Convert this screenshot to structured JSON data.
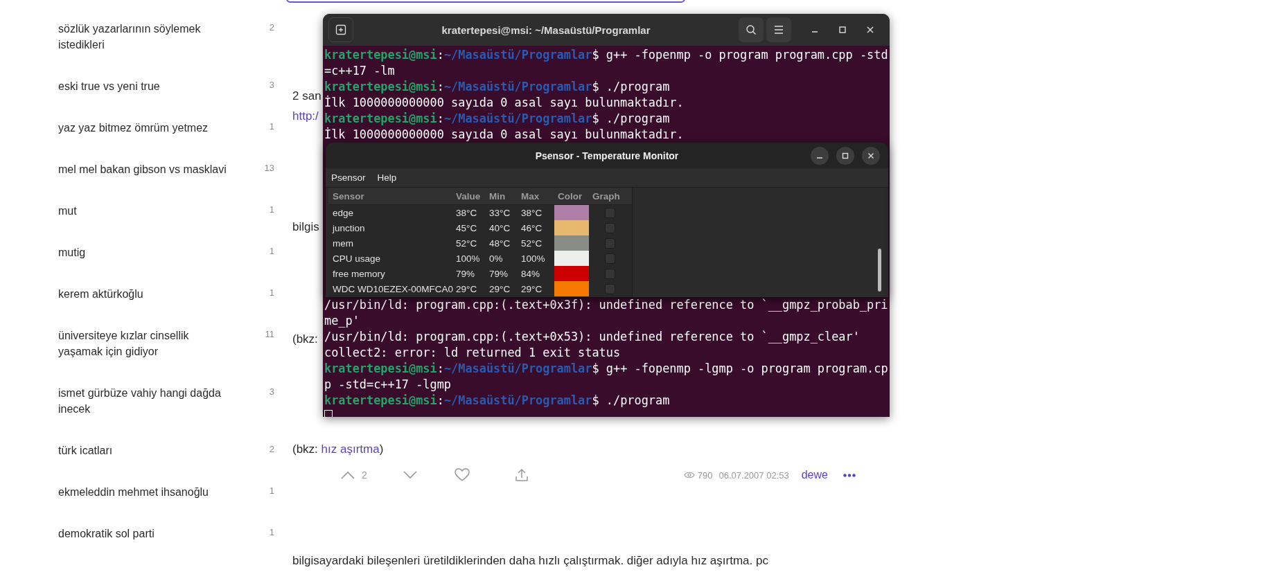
{
  "sidebar": {
    "items": [
      {
        "title": "sözlük yazarlarının söylemek istedikleri",
        "count": "2"
      },
      {
        "title": "eski true vs yeni true",
        "count": "3"
      },
      {
        "title": "yaz yaz bitmez ömrüm yetmez",
        "count": "1"
      },
      {
        "title": "mel mel bakan gibson vs masklavi",
        "count": "13"
      },
      {
        "title": "mut",
        "count": "1"
      },
      {
        "title": "mutig",
        "count": "1"
      },
      {
        "title": "kerem aktürkoğlu",
        "count": "1"
      },
      {
        "title": "üniversiteye kızlar cinsellik yaşamak için gidiyor",
        "count": "11"
      },
      {
        "title": "ismet gürbüze vahiy hangi dağda inecek",
        "count": "3"
      },
      {
        "title": "türk icatları",
        "count": "2"
      },
      {
        "title": "ekmeleddin mehmet ihsanoğlu",
        "count": "1"
      },
      {
        "title": "demokratik sol parti",
        "count": "1"
      }
    ]
  },
  "content": {
    "blocks": [
      {
        "kind": "text",
        "text": "2 san"
      },
      {
        "kind": "link",
        "text": "http:/"
      },
      {
        "kind": "text",
        "text": "bilgis"
      },
      {
        "kind": "text",
        "text": "(bkz:"
      },
      {
        "kind": "bkz",
        "prefix": "(bkz: ",
        "link": "hız aşırtma",
        "suffix": ")"
      },
      {
        "kind": "footer",
        "upvotes": "2",
        "views": "790",
        "date": "06.07.2007 02:53",
        "author": "dewe"
      },
      {
        "kind": "text",
        "text": "bilgisayardaki bileşenleri üretildiklerinden daha hızlı çalıştırmak. diğer adıyla hız aşırtma. pc"
      }
    ]
  },
  "terminal": {
    "title": "kratertepesi@msi: ~/Masaüstü/Programlar",
    "cursor_visible": true,
    "lines_top": [
      {
        "kind": "prompt",
        "user": "kratertepesi@msi",
        "separator": ":",
        "path": "~/Masaüstü/Programlar",
        "command": "$ g++ -fopenmp -o program program.cpp -std"
      },
      {
        "kind": "output",
        "text": "=c++17 -lm"
      },
      {
        "kind": "prompt",
        "user": "kratertepesi@msi",
        "separator": ":",
        "path": "~/Masaüstü/Programlar",
        "command": "$ ./program"
      },
      {
        "kind": "output",
        "text": "İlk 1000000000000 sayıda 0 asal sayı bulunmaktadır."
      },
      {
        "kind": "prompt",
        "user": "kratertepesi@msi",
        "separator": ":",
        "path": "~/Masaüstü/Programlar",
        "command": "$ ./program"
      },
      {
        "kind": "output",
        "text": "İlk 1000000000000 sayıda 0 asal sayı bulunmaktadır."
      }
    ],
    "lines_bottom": [
      {
        "kind": "output",
        "text": "/usr/bin/ld: program.cpp:(.text+0x3f): undefined reference to `__gmpz_probab_pri"
      },
      {
        "kind": "output",
        "text": "me_p'"
      },
      {
        "kind": "output",
        "text": "/usr/bin/ld: program.cpp:(.text+0x53): undefined reference to `__gmpz_clear'"
      },
      {
        "kind": "output",
        "text": "collect2: error: ld returned 1 exit status"
      },
      {
        "kind": "prompt",
        "user": "kratertepesi@msi",
        "separator": ":",
        "path": "~/Masaüstü/Programlar",
        "command": "$ g++ -fopenmp -lgmp -o program program.cp"
      },
      {
        "kind": "output",
        "text": "p -std=c++17 -lgmp"
      },
      {
        "kind": "prompt",
        "user": "kratertepesi@msi",
        "separator": ":",
        "path": "~/Masaüstü/Programlar",
        "command": "$ ./program"
      }
    ]
  },
  "psensor": {
    "title": "Psensor - Temperature Monitor",
    "menu": [
      "Psensor",
      "Help"
    ],
    "columns": [
      "Sensor",
      "Value",
      "Min",
      "Max",
      "Color",
      "Graph"
    ],
    "rows": [
      {
        "sensor": "edge",
        "value": "38°C",
        "min": "33°C",
        "max": "38°C",
        "color": "#b07fa8",
        "checked": false
      },
      {
        "sensor": "junction",
        "value": "45°C",
        "min": "40°C",
        "max": "46°C",
        "color": "#e8b86e",
        "checked": false
      },
      {
        "sensor": "mem",
        "value": "52°C",
        "min": "48°C",
        "max": "52°C",
        "color": "#8a8d86",
        "checked": false
      },
      {
        "sensor": "CPU usage",
        "value": "100%",
        "min": "0%",
        "max": "100%",
        "color": "#eeeeec",
        "checked": false
      },
      {
        "sensor": "free memory",
        "value": "79%",
        "min": "79%",
        "max": "84%",
        "color": "#cc0000",
        "checked": false
      },
      {
        "sensor": "WDC WD10EZEX-00MFCA0",
        "value": "29°C",
        "min": "29°C",
        "max": "29°C",
        "color": "#f57900",
        "checked": false
      }
    ]
  }
}
